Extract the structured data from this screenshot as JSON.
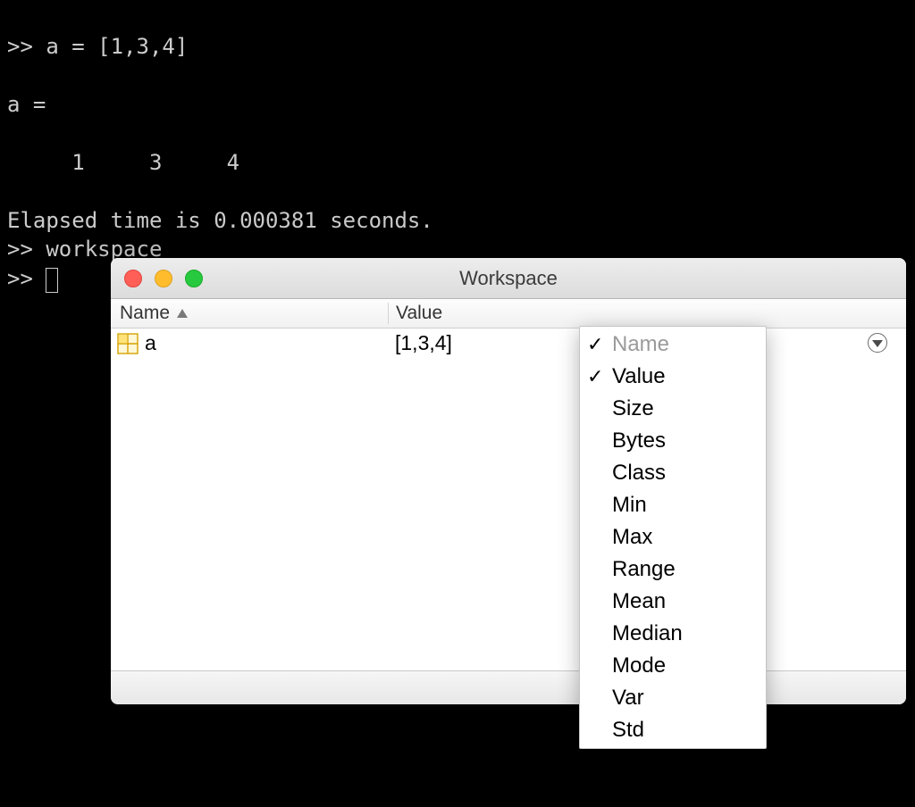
{
  "terminal": {
    "line1": ">> a = [1,3,4]",
    "line2": "",
    "line3": "a =",
    "line4": "",
    "line5": "     1     3     4",
    "line6": "",
    "line7": "Elapsed time is 0.000381 seconds.",
    "line8": ">> workspace",
    "line9_prefix": ">> "
  },
  "workspace": {
    "title": "Workspace",
    "columns": {
      "name": "Name",
      "value": "Value"
    },
    "rows": [
      {
        "name": "a",
        "value": "[1,3,4]"
      }
    ]
  },
  "context_menu": {
    "items": [
      {
        "label": "Name",
        "checked": true,
        "disabled": true
      },
      {
        "label": "Value",
        "checked": true,
        "disabled": false
      },
      {
        "label": "Size",
        "checked": false,
        "disabled": false
      },
      {
        "label": "Bytes",
        "checked": false,
        "disabled": false
      },
      {
        "label": "Class",
        "checked": false,
        "disabled": false
      },
      {
        "label": "Min",
        "checked": false,
        "disabled": false
      },
      {
        "label": "Max",
        "checked": false,
        "disabled": false
      },
      {
        "label": "Range",
        "checked": false,
        "disabled": false
      },
      {
        "label": "Mean",
        "checked": false,
        "disabled": false
      },
      {
        "label": "Median",
        "checked": false,
        "disabled": false
      },
      {
        "label": "Mode",
        "checked": false,
        "disabled": false
      },
      {
        "label": "Var",
        "checked": false,
        "disabled": false
      },
      {
        "label": "Std",
        "checked": false,
        "disabled": false
      }
    ]
  }
}
